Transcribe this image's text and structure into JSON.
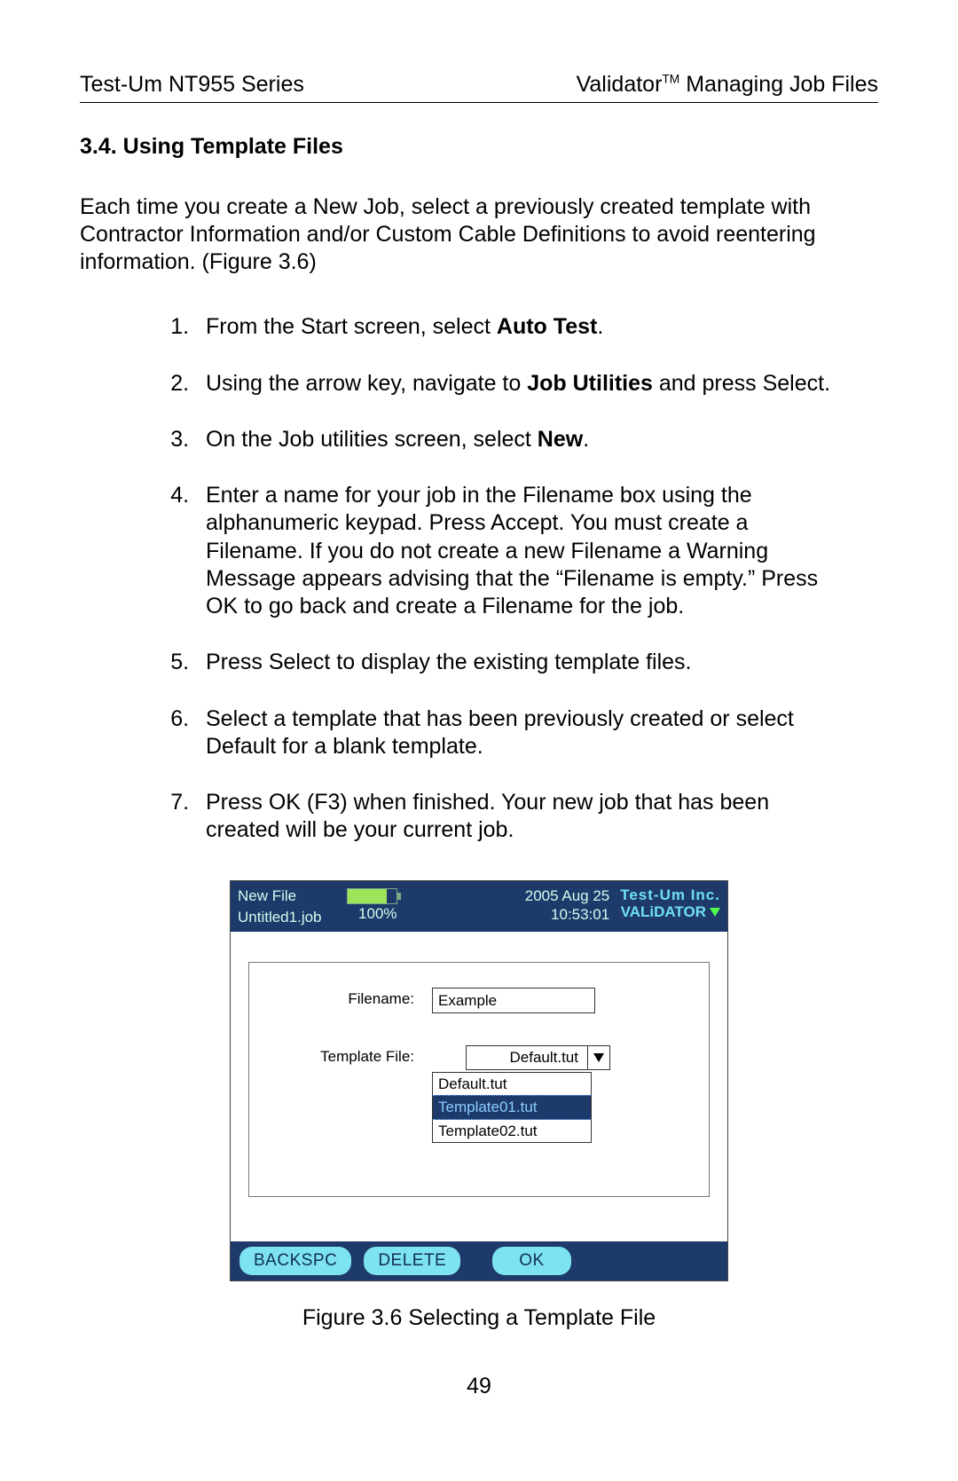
{
  "header": {
    "left": "Test-Um NT955 Series",
    "right_product": "Validator",
    "right_tm": "TM",
    "right_suffix": " Managing Job Files"
  },
  "section_title": "3.4. Using Template Files",
  "intro": "Each time you create a New Job, select a previously created template with Contractor Information and/or Custom Cable Definitions to avoid reentering information. (Figure 3.6)",
  "steps": {
    "s1_a": "From the Start screen, select ",
    "s1_b": "Auto Test",
    "s1_c": ".",
    "s2_a": "Using the arrow key, navigate to ",
    "s2_b": "Job Utilities",
    "s2_c": " and press Select.",
    "s3_a": "On the Job utilities screen, select ",
    "s3_b": "New",
    "s3_c": ".",
    "s4": "Enter a name for your job in the Filename box using the alphanumeric keypad. Press Accept. You must create a Filename. If you do not create a new Filename a Warning Message appears advising that the “Filename is empty.” Press OK to go back and create a Filename for the job.",
    "s5": "Press Select to display the existing template files.",
    "s6": "Select a template that has been previously created or select Default for a blank template.",
    "s7": "Press OK (F3) when finished. Your new job that has been created will be your current job."
  },
  "device": {
    "top": {
      "title": "New File",
      "jobfile": "Untitled1.job",
      "battery_pct": "100%",
      "date": "2005 Aug 25",
      "time": "10:53:01",
      "company": "Test-Um Inc.",
      "product": "VALiDATOR"
    },
    "form": {
      "filename_label": "Filename:",
      "filename_value": "Example",
      "template_label": "Template File:",
      "template_selected": "Default.tut",
      "template_options": {
        "o0": "Default.tut",
        "o1": "Template01.tut",
        "o2": "Template02.tut"
      }
    },
    "softkeys": {
      "k1": "BACKSPC",
      "k2": "DELETE",
      "k3": "OK"
    }
  },
  "caption": "Figure 3.6 Selecting a Template File",
  "page_number": "49"
}
